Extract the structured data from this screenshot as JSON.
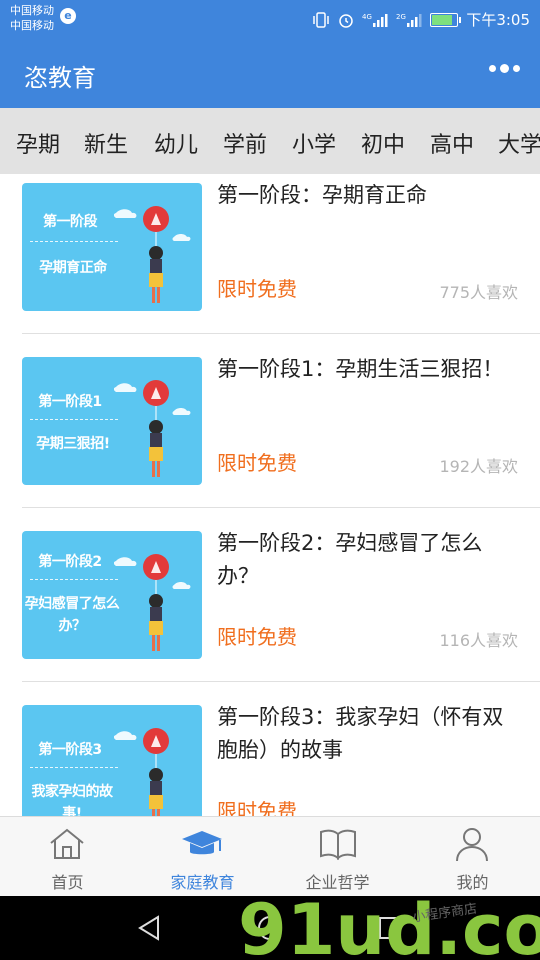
{
  "status_bar": {
    "carrier_1": "中国移动",
    "carrier_2": "中国移动",
    "time": "下午3:05",
    "net_1": "4G",
    "net_2": "2G",
    "battery_level": 0.85
  },
  "app_bar": {
    "title": "恣教育"
  },
  "tabs": [
    "孕期",
    "新生",
    "幼儿",
    "学前",
    "小学",
    "初中",
    "高中",
    "大学"
  ],
  "courses": [
    {
      "thumb_line1": "第一阶段",
      "thumb_line2": "孕期育正命",
      "title": "第一阶段：孕期育正命",
      "price": "限时免费",
      "likes": "775人喜欢"
    },
    {
      "thumb_line1": "第一阶段1",
      "thumb_line2": "孕期三狠招!",
      "title": "第一阶段1：孕期生活三狠招！",
      "price": "限时免费",
      "likes": "192人喜欢"
    },
    {
      "thumb_line1": "第一阶段2",
      "thumb_line2": "孕妇感冒了怎么办？",
      "title": "第一阶段2：孕妇感冒了怎么办？",
      "price": "限时免费",
      "likes": "116人喜欢"
    },
    {
      "thumb_line1": "第一阶段3",
      "thumb_line2": "我家孕妇的故事!",
      "title": "第一阶段3：我家孕妇（怀有双胞胎）的故事",
      "price": "限时免费",
      "likes": ""
    }
  ],
  "bottom_nav": [
    {
      "label": "首页",
      "icon": "home-icon"
    },
    {
      "label": "家庭教育",
      "icon": "graduation-cap-icon"
    },
    {
      "label": "企业哲学",
      "icon": "book-icon"
    },
    {
      "label": "我的",
      "icon": "person-icon"
    }
  ],
  "watermark": {
    "text": "91ud.com",
    "subtext": "小程序商店"
  },
  "colors": {
    "primary": "#3f85dc",
    "accent_orange": "#f06e1e",
    "thumb_bg": "#5bc6f1"
  }
}
